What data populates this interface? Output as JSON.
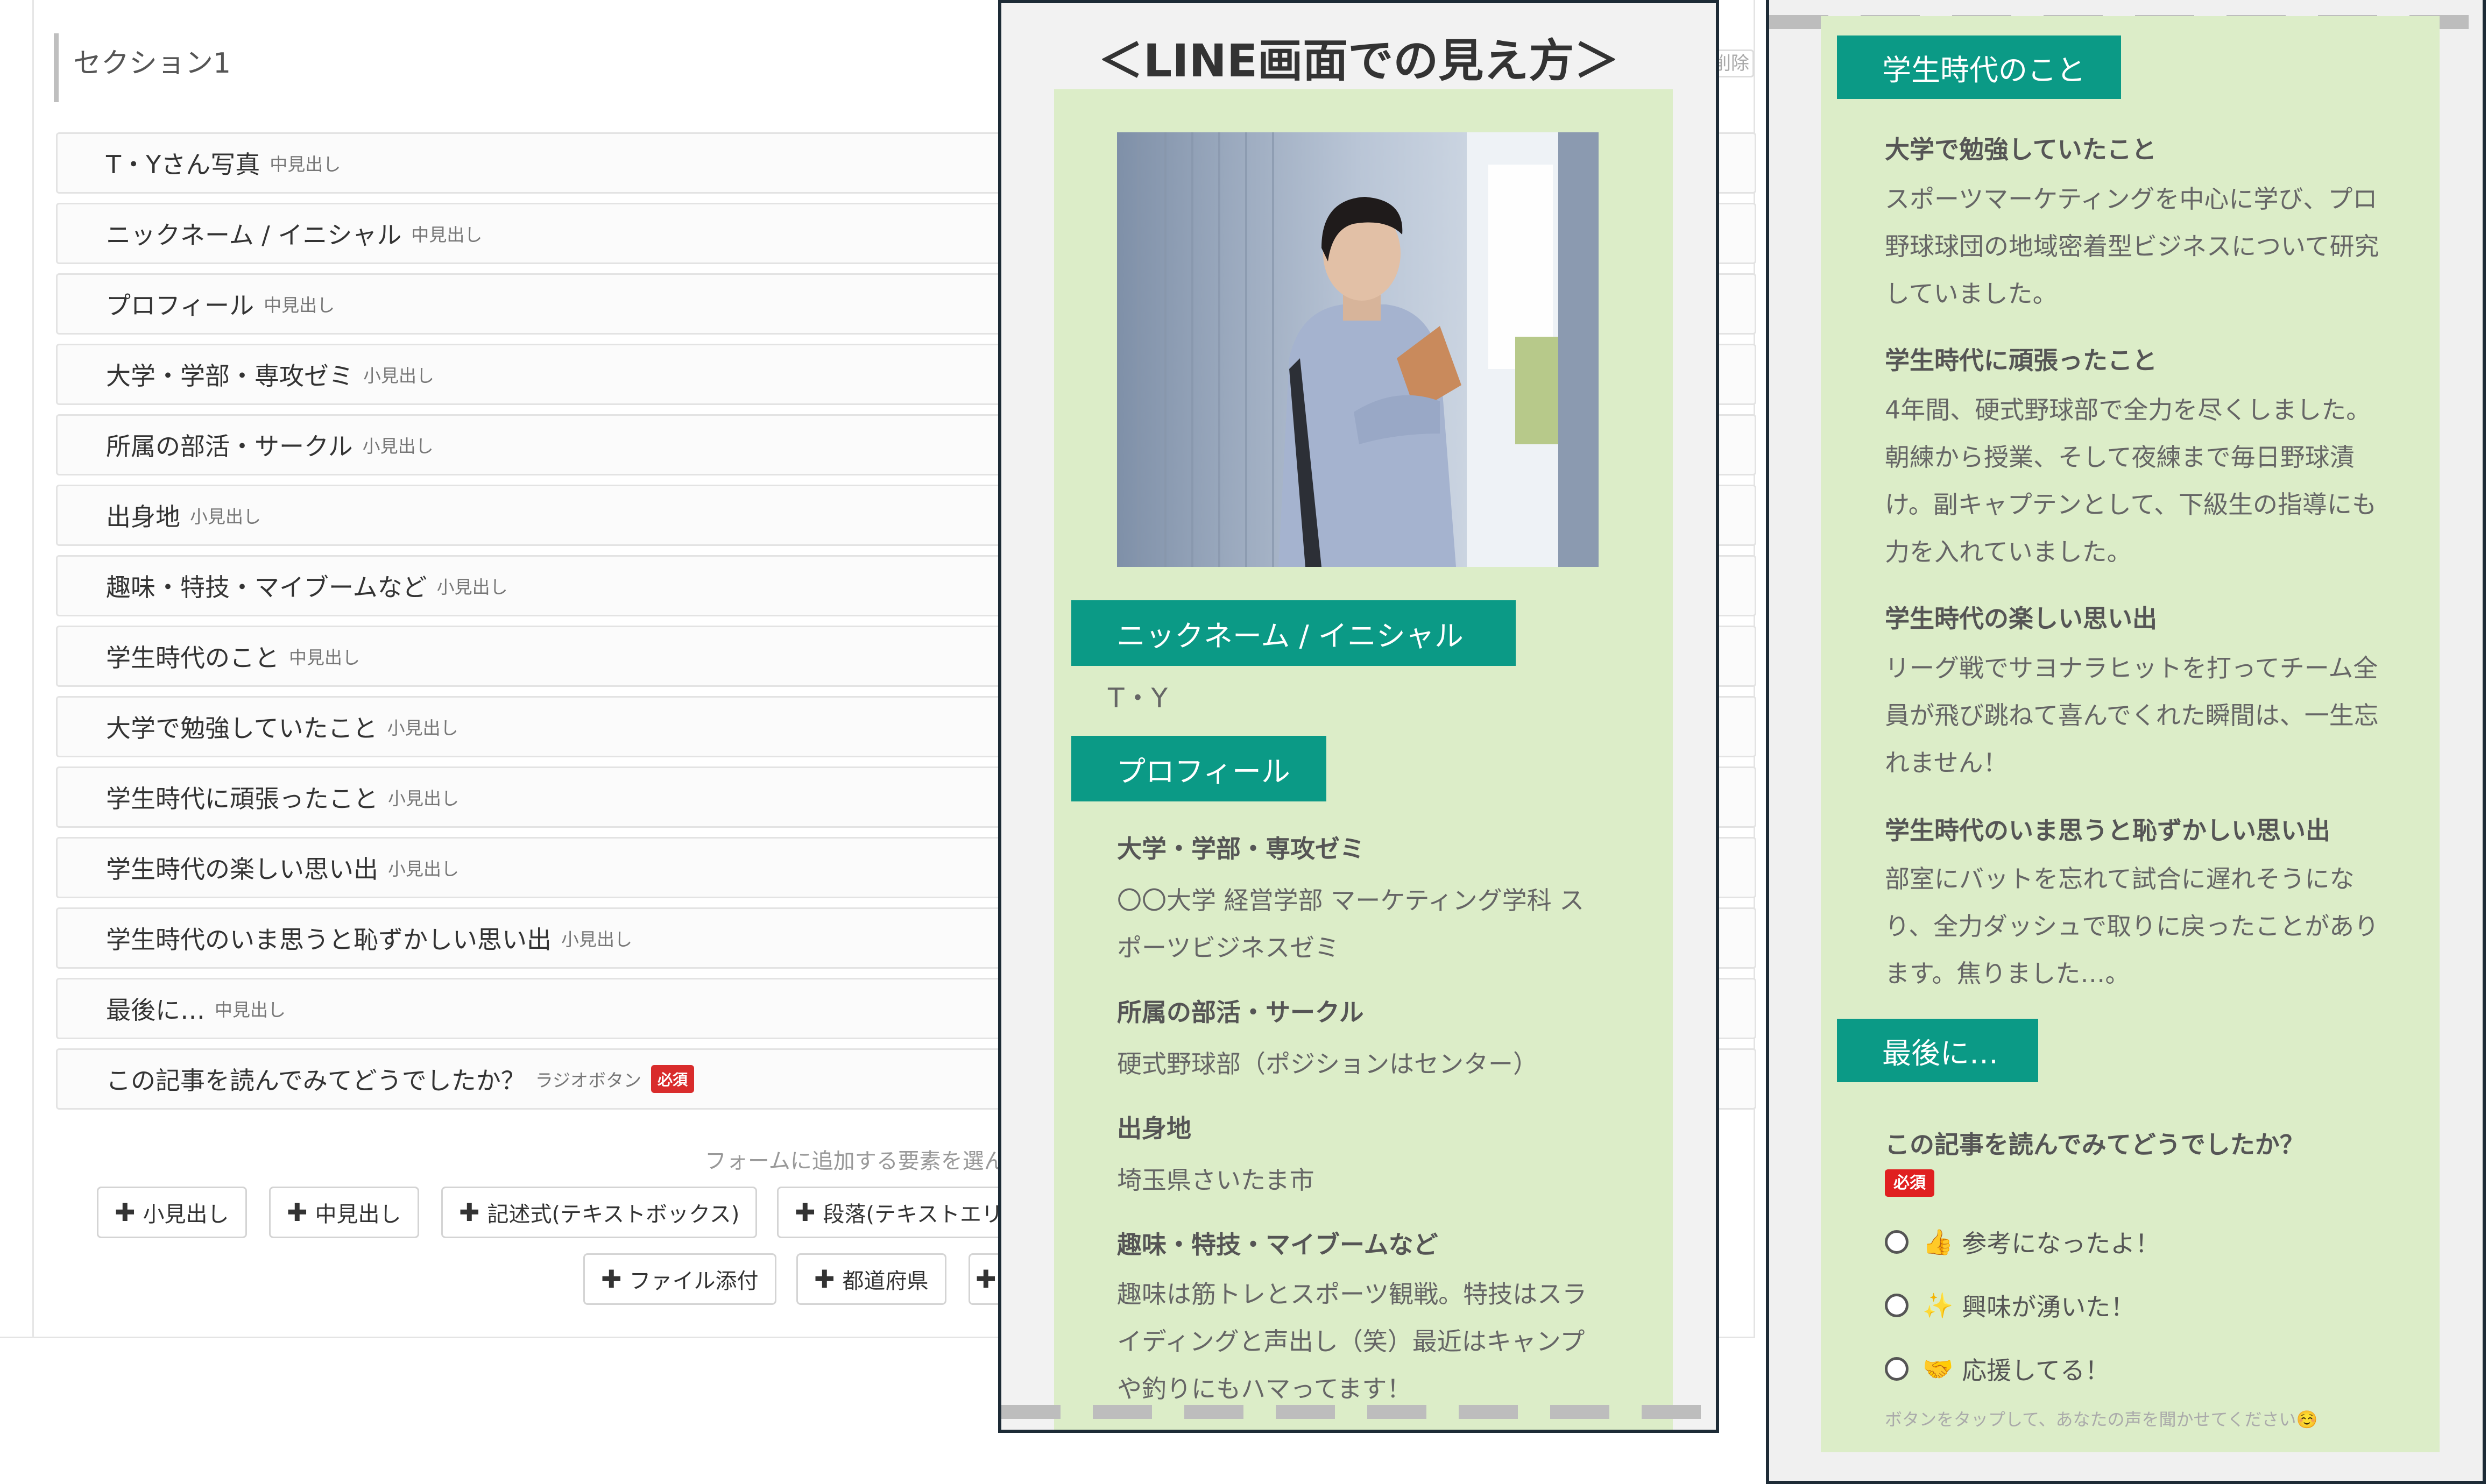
{
  "editor": {
    "section_title": "セクション1",
    "delete_label": "削除",
    "rows": [
      {
        "label": "T・Yさん写真",
        "type": "中見出し"
      },
      {
        "label": "ニックネーム / イニシャル",
        "type": "中見出し"
      },
      {
        "label": "プロフィール",
        "type": "中見出し"
      },
      {
        "label": "大学・学部・専攻ゼミ",
        "type": "小見出し"
      },
      {
        "label": "所属の部活・サークル",
        "type": "小見出し"
      },
      {
        "label": "出身地",
        "type": "小見出し"
      },
      {
        "label": "趣味・特技・マイブームなど",
        "type": "小見出し"
      },
      {
        "label": "学生時代のこと",
        "type": "中見出し"
      },
      {
        "label": "大学で勉強していたこと",
        "type": "小見出し"
      },
      {
        "label": "学生時代に頑張ったこと",
        "type": "小見出し"
      },
      {
        "label": "学生時代の楽しい思い出",
        "type": "小見出し"
      },
      {
        "label": "学生時代のいま思うと恥ずかしい思い出",
        "type": "小見出し"
      },
      {
        "label": "最後に…",
        "type": "中見出し"
      },
      {
        "label": "この記事を読んでみてどうでしたか？",
        "type": "ラジオボタン",
        "required": "必須"
      }
    ],
    "add_hint": "フォームに追加する要素を選ん",
    "add_buttons_row1": [
      "小見出し",
      "中見出し",
      "記述式(テキストボックス)",
      "段落(テキストエリ"
    ],
    "add_buttons_row2": [
      "ファイル添付",
      "都道府県"
    ],
    "plus_glyph": "✚"
  },
  "preview_left": {
    "title": "＜LINE画面での見え方＞",
    "nickname_heading": "ニックネーム / イニシャル",
    "nickname_value": "T・Y",
    "profile_heading": "プロフィール",
    "items": [
      {
        "label": "大学・学部・専攻ゼミ",
        "text": "〇〇大学 経営学部 マーケティング学科 スポーツビジネスゼミ"
      },
      {
        "label": "所属の部活・サークル",
        "text": "硬式野球部（ポジションはセンター）"
      },
      {
        "label": "出身地",
        "text": "埼玉県さいたま市"
      },
      {
        "label": "趣味・特技・マイブームなど",
        "text": "趣味は筋トレとスポーツ観戦。特技はスライディングと声出し（笑）最近はキャンプや釣りにもハマってます！"
      }
    ]
  },
  "preview_right": {
    "student_heading": "学生時代のこと",
    "items": [
      {
        "label": "大学で勉強していたこと",
        "text": "スポーツマーケティングを中心に学び、プロ野球球団の地域密着型ビジネスについて研究していました。"
      },
      {
        "label": "学生時代に頑張ったこと",
        "text": "4年間、硬式野球部で全力を尽くしました。朝練から授業、そして夜練まで毎日野球漬け。副キャプテンとして、下級生の指導にも力を入れていました。"
      },
      {
        "label": "学生時代の楽しい思い出",
        "text": "リーグ戦でサヨナラヒットを打ってチーム全員が飛び跳ねて喜んでくれた瞬間は、一生忘れません！"
      },
      {
        "label": "学生時代のいま思うと恥ずかしい思い出",
        "text": "部室にバットを忘れて試合に遅れそうになり、全力ダッシュで取りに戻ったことがあります。焦りました…。"
      }
    ],
    "last_heading": "最後に…",
    "question": "この記事を読んでみてどうでしたか？",
    "required": "必須",
    "options": [
      {
        "emoji": "👍",
        "label": "参考になったよ！"
      },
      {
        "emoji": "✨",
        "label": "興味が湧いた！"
      },
      {
        "emoji": "🤝",
        "label": "応援してる！"
      }
    ],
    "footnote": "ボタンをタップして、あなたの声を聞かせてください☺️"
  }
}
